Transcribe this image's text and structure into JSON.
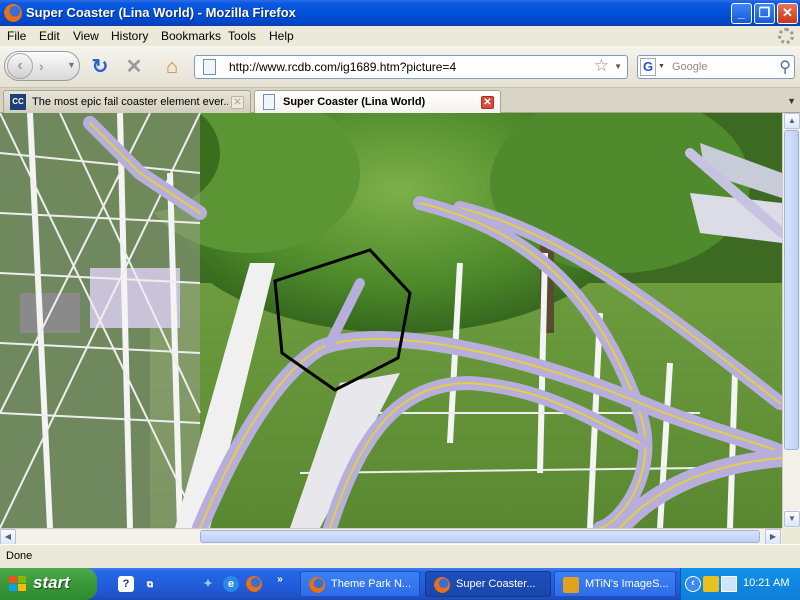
{
  "window": {
    "title": "Super Coaster (Lina World) - Mozilla Firefox",
    "buttons": {
      "minimize": "_",
      "maximize": "❐",
      "close": "✕"
    }
  },
  "menubar": {
    "items": [
      "File",
      "Edit",
      "View",
      "History",
      "Bookmarks",
      "Tools",
      "Help"
    ]
  },
  "navbar": {
    "url": "http://www.rcdb.com/ig1689.htm?picture=4",
    "search_placeholder": "Google",
    "search_engine_letter": "G"
  },
  "tabs": [
    {
      "label": "The most epic fail coaster element ever...",
      "favicon": "CC",
      "active": false
    },
    {
      "label": "Super Coaster (Lina World)",
      "active": true
    }
  ],
  "content": {
    "image_subject": "roller-coaster-photo"
  },
  "statusbar": {
    "status": "Done"
  },
  "taskbar": {
    "start_label": "start",
    "tasks": [
      {
        "label": "Theme Park N...",
        "active": false
      },
      {
        "label": "Super Coaster...",
        "active": true
      },
      {
        "label": "MTiN's ImageS...",
        "active": false
      }
    ],
    "clock": "10:21 AM"
  },
  "colors": {
    "titlebar": "#0050D8",
    "taskbar": "#245EDC",
    "start_button": "#3C9C3C",
    "tray": "#0F7FD8",
    "chrome": "#ECE9D8"
  }
}
